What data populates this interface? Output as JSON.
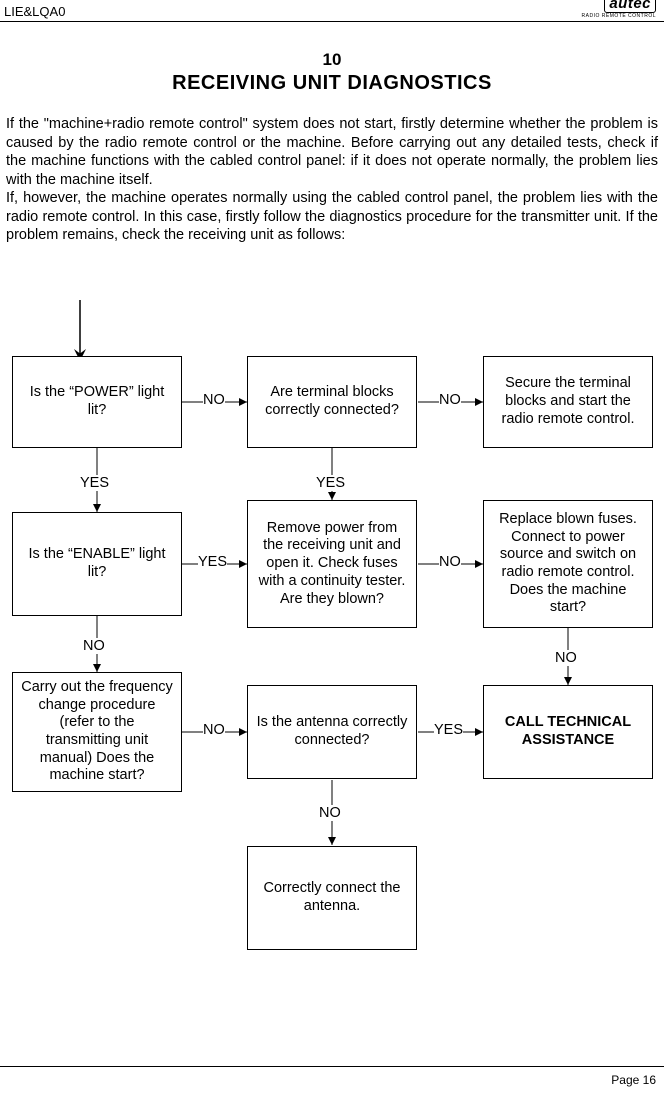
{
  "header": {
    "doc_id": "LIE&LQA0",
    "logo_main": "autec",
    "logo_sub": "RADIO REMOTE CONTROL"
  },
  "section": {
    "number": "10",
    "title": "RECEIVING UNIT DIAGNOSTICS"
  },
  "body": {
    "p1": "If the \"machine+radio remote control\" system does not start, firstly determine  whether the problem is caused by the radio remote control or the machine. Before carrying out any detailed tests, check if the machine functions with the cabled control panel: if it does not operate normally, the problem lies with the machine itself.",
    "p2": "If, however, the machine operates normally using the cabled control panel, the problem lies with the radio remote control.  In this case, firstly follow the diagnostics procedure for the transmitter unit. If the problem remains,  check the receiving unit as follows:"
  },
  "flow": {
    "box_power": "Is the “POWER” light lit?",
    "box_terminal": "Are terminal blocks correctly connected?",
    "box_secure": "Secure the terminal blocks and start the radio remote control.",
    "box_enable": "Is the “ENABLE” light lit?",
    "box_fuses": "Remove power from the receiving unit and open it. Check fuses with a continuity tester. Are they blown?",
    "box_replace": "Replace blown fuses. Connect to power source and switch on radio remote control. Does the machine start?",
    "box_freq": "Carry out the frequency change procedure (refer to the transmitting unit manual)  Does the machine start?",
    "box_antenna": "Is the antenna correctly connected?",
    "box_call": "CALL TECHNICAL ASSISTANCE",
    "box_connect": "Correctly connect the antenna."
  },
  "labels": {
    "yes": "YES",
    "no": "NO"
  },
  "footer": {
    "page": "Page 16"
  }
}
